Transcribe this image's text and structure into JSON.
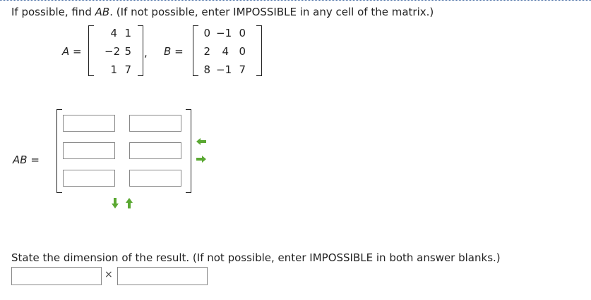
{
  "question": {
    "prompt_parts": {
      "pre": "If possible, find ",
      "product": "AB",
      "post": ". (If not possible, enter IMPOSSIBLE in any cell of the matrix.)"
    }
  },
  "matrix_a": {
    "label": "A",
    "equals": "=",
    "rows": [
      [
        "4",
        "1"
      ],
      [
        "−2",
        "5"
      ],
      [
        "1",
        "7"
      ]
    ],
    "trailing": ","
  },
  "matrix_b": {
    "label": "B",
    "equals": "=",
    "rows": [
      [
        "0",
        "−1",
        "0"
      ],
      [
        "2",
        "4",
        "0"
      ],
      [
        "8",
        "−1",
        "7"
      ]
    ]
  },
  "answer": {
    "label": "AB",
    "equals": "=",
    "cells": [
      [
        "",
        ""
      ],
      [
        "",
        ""
      ],
      [
        "",
        ""
      ]
    ]
  },
  "controls": {
    "remove_column_icon": "left-arrow-icon",
    "add_column_icon": "right-arrow-icon",
    "add_row_icon": "down-arrow-icon",
    "remove_row_icon": "up-arrow-icon",
    "arrow_color": "#5aa832"
  },
  "dimension": {
    "prompt": "State the dimension of the result. (If not possible, enter IMPOSSIBLE in both answer blanks.)",
    "rows_value": "",
    "times": "×",
    "cols_value": ""
  }
}
